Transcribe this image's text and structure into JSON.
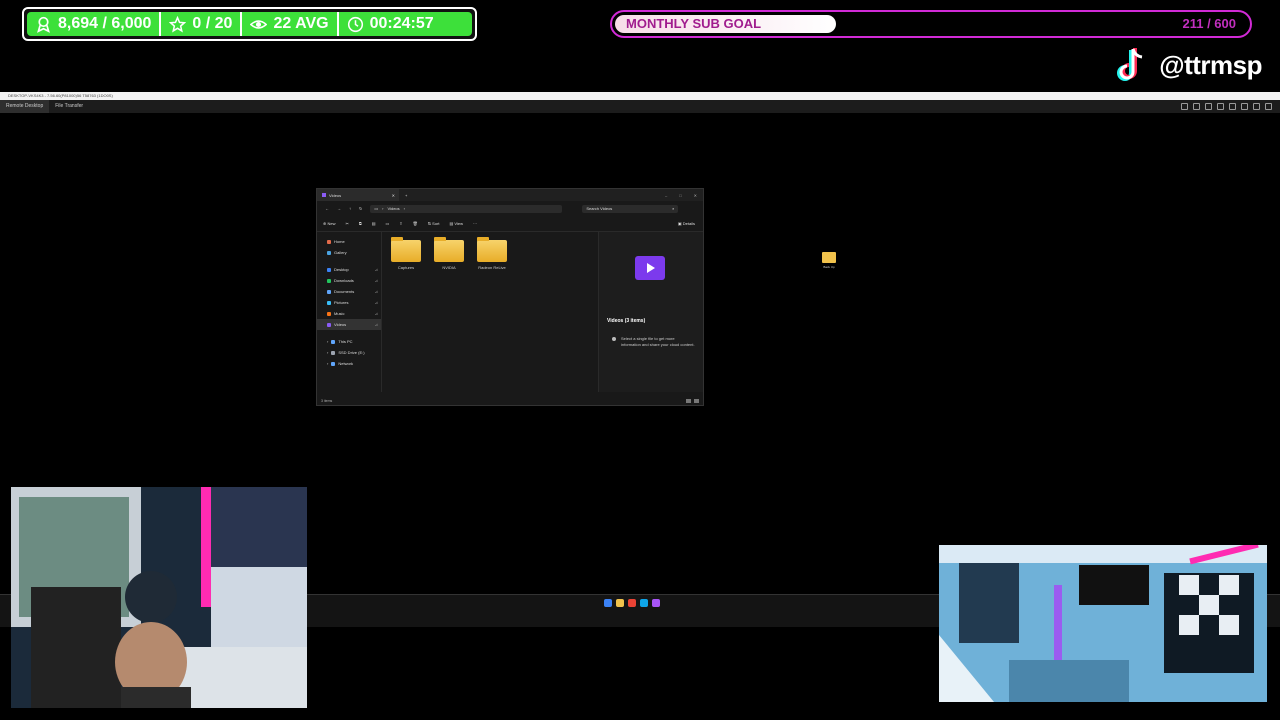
{
  "overlay": {
    "stats": {
      "followers": "8,694 / 6,000",
      "stars": "0 / 20",
      "viewers": "22 AVG",
      "uptime": "00:24:57"
    },
    "goal": {
      "label": "MONTHLY SUB GOAL",
      "count": "211 / 600",
      "progress": 0.35
    },
    "social": {
      "handle": "@ttrmsp"
    }
  },
  "remote_desktop": {
    "title": "DESKTOP-VKS4K3 - 7.56.60(P81000)56 T58763 (1DO0S)",
    "tabs": [
      "Remote Desktop",
      "File Transfer"
    ]
  },
  "desktop": {
    "folder_label": "Back Up"
  },
  "explorer": {
    "tab_title": "Videos",
    "path": "Videos",
    "search_placeholder": "Search Videos",
    "commands": {
      "new": "New",
      "sort": "Sort",
      "view": "View",
      "more": "···",
      "details": "Details"
    },
    "nav": {
      "home": "Home",
      "gallery": "Gallery",
      "desktop": "Desktop",
      "downloads": "Downloads",
      "documents": "Documents",
      "pictures": "Pictures",
      "music": "Music",
      "videos": "Videos",
      "this_pc": "This PC",
      "drive": "SSD Drive (E:)",
      "network": "Network"
    },
    "folders": [
      "Captures",
      "NVIDIA",
      "Radeon ReLive"
    ],
    "details": {
      "title": "Videos (3 items)",
      "info": "Select a single file to get more information and share your cloud content."
    },
    "status": "3 items"
  },
  "colors": {
    "stats_green": "#3de03a",
    "goal_border": "#d12ad6",
    "folder_yellow": "#f1c24c",
    "accent_purple": "#7c3aed"
  }
}
